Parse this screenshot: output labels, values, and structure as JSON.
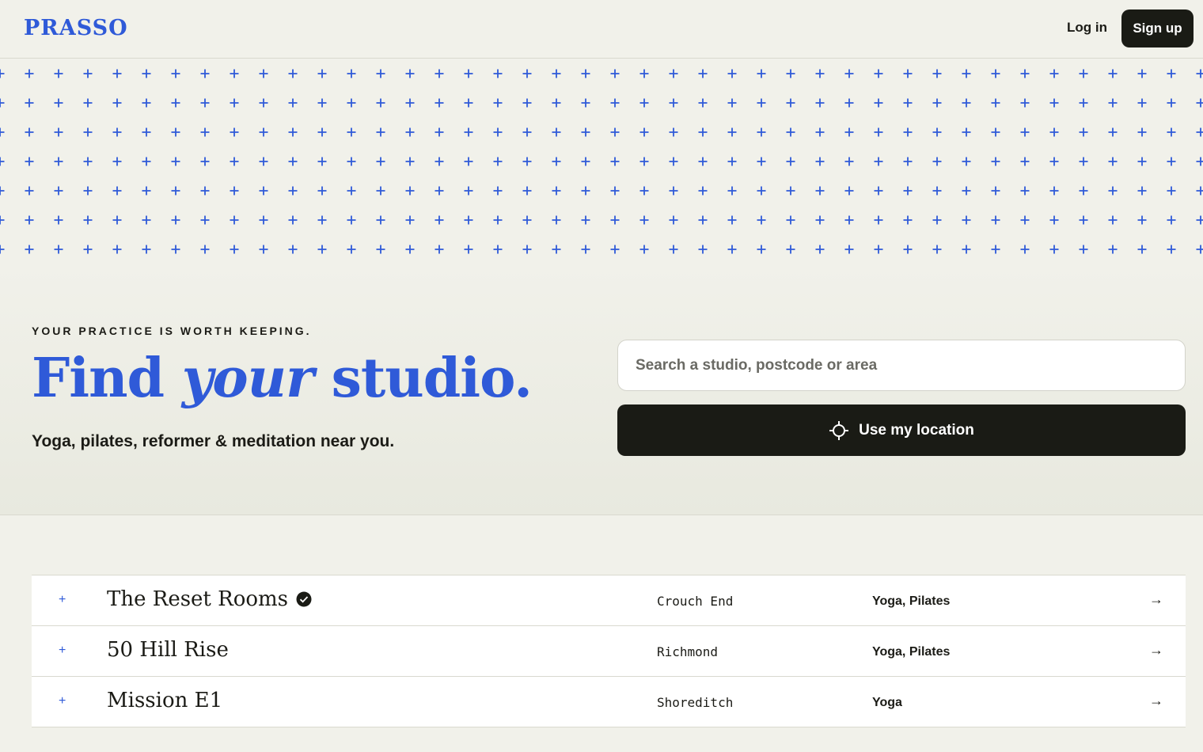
{
  "header": {
    "logo": "PRASSO",
    "login_label": "Log in",
    "signup_label": "Sign up"
  },
  "hero": {
    "eyebrow": "YOUR PRACTICE IS WORTH KEEPING.",
    "headline_start": "Find ",
    "headline_emphasis": "your",
    "headline_end": " studio.",
    "subline": "Yoga, pilates, reformer & meditation near you.",
    "search_placeholder": "Search a studio, postcode or area",
    "search_value": "",
    "location_label": "Use my location"
  },
  "studios": [
    {
      "name": "The Reset Rooms",
      "verified": true,
      "area": "Crouch End",
      "types": "Yoga, Pilates"
    },
    {
      "name": "50 Hill Rise",
      "verified": false,
      "area": "Richmond",
      "types": "Yoga, Pilates"
    },
    {
      "name": "Mission E1",
      "verified": false,
      "area": "Shoreditch",
      "types": "Yoga"
    }
  ],
  "icons": {
    "pattern": "plus-pattern-icon",
    "location": "crosshair-icon",
    "verified": "verified-check-icon",
    "row_marker": "plus-icon",
    "row_arrow": "arrow-right-icon"
  },
  "colors": {
    "brand_blue": "#2f5ad8",
    "ink": "#1a1b15",
    "background": "#f1f1ea"
  }
}
